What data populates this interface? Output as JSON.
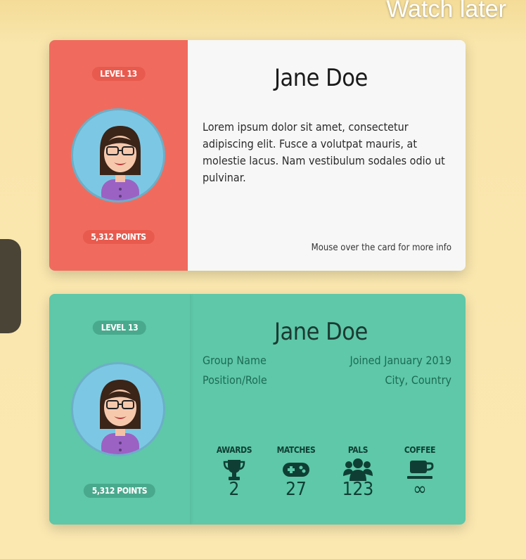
{
  "overlay": {
    "watch_later": "Watch later"
  },
  "card_basic": {
    "level": "LEVEL 13",
    "points": "5,312 POINTS",
    "name": "Jane Doe",
    "bio": "Lorem ipsum dolor sit amet, consectetur adipiscing elit. Fusce a volutpat mauris, at molestie lacus. Nam vestibulum sodales odio ut pulvinar.",
    "hint": "Mouse over the card for more info"
  },
  "card_detail": {
    "level": "LEVEL 13",
    "points": "5,312 POINTS",
    "name": "Jane Doe",
    "group": "Group Name",
    "joined": "Joined January 2019",
    "role": "Position/Role",
    "location": "City, Country",
    "stats": [
      {
        "label": "AWARDS",
        "value": "2",
        "icon": "trophy-icon"
      },
      {
        "label": "MATCHES",
        "value": "27",
        "icon": "gamepad-icon"
      },
      {
        "label": "PALS",
        "value": "123",
        "icon": "users-icon"
      },
      {
        "label": "COFFEE",
        "value": "∞",
        "icon": "coffee-icon"
      }
    ]
  },
  "colors": {
    "background": "#fbe8b1",
    "card_basic_accent": "#f06b5e",
    "card_detail_accent": "#5ec8a8",
    "avatar_bg": "#7cc8e4"
  }
}
